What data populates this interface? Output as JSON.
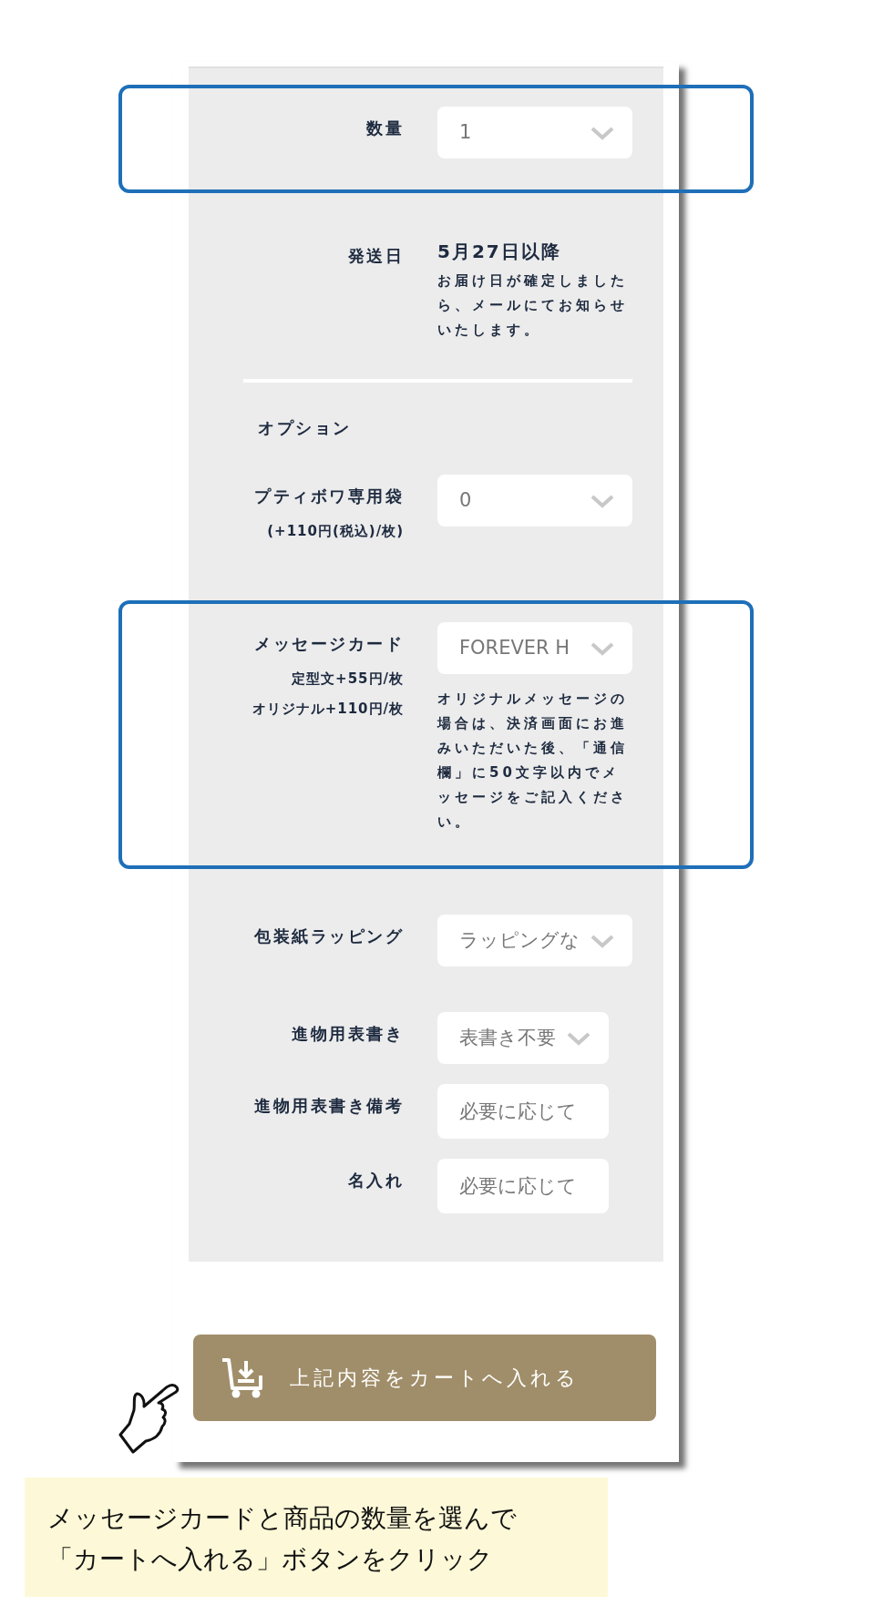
{
  "rows": [
    {
      "label": "数量",
      "kind": "select",
      "value": "1",
      "highlighted": true
    },
    {
      "label": "発送日",
      "kind": "info",
      "value": "5月27日以降",
      "note": "お届け日が確定しましたら、メールにてお知らせいたします。",
      "highlighted": false
    }
  ],
  "options": {
    "heading": "オプション",
    "rows": [
      {
        "label": "プティボワ専用袋",
        "kind": "select",
        "value": "0",
        "sublabels": [
          "(+110円(税込)/枚)"
        ],
        "highlighted": false
      },
      {
        "label": "メッセージカード",
        "kind": "select",
        "value": "FOREVER H",
        "sublabels": [
          "定型文+55円/枚",
          "オリジナル+110円/枚"
        ],
        "note": "オリジナルメッセージの場合は、決済画面にお進みいただいた後、「通信欄」に50文字以内でメッセージをご記入ください。",
        "highlighted": true
      },
      {
        "label": "包装紙ラッピング",
        "kind": "select",
        "value": "ラッピングな",
        "highlighted": false
      },
      {
        "label": "進物用表書き",
        "kind": "select",
        "value": "表書き不要",
        "narrow": true,
        "highlighted": false
      },
      {
        "label": "進物用表書き備考",
        "kind": "text",
        "placeholder": "必要に応じて",
        "highlighted": false
      },
      {
        "label": "名入れ",
        "kind": "text",
        "placeholder": "必要に応じて",
        "highlighted": false
      }
    ]
  },
  "cart_button": {
    "label": "上記内容をカートへ入れる"
  },
  "instruction": {
    "lines": [
      "メッセージカードと商品の数量を選んで",
      "「カートへ入れる」ボタンをクリック"
    ]
  }
}
